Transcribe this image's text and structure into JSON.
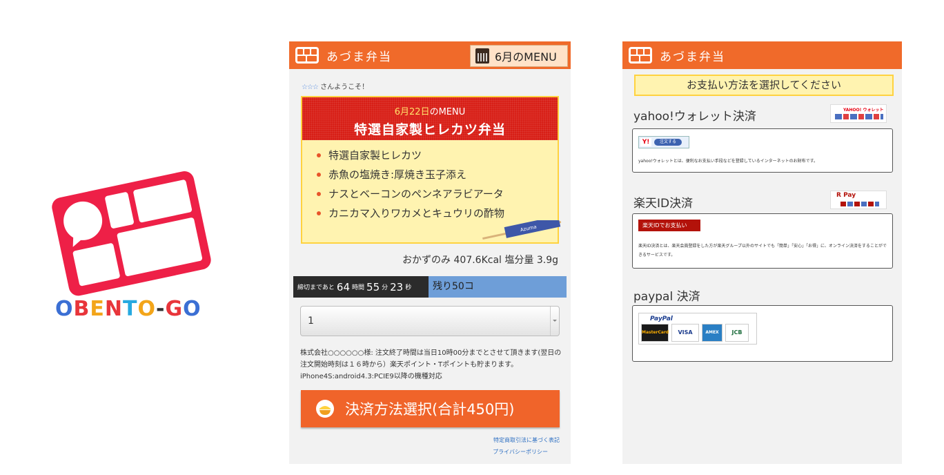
{
  "brand": {
    "wordmark": [
      {
        "ch": "O",
        "color": "#3b6fd4"
      },
      {
        "ch": "B",
        "color": "#e8353b"
      },
      {
        "ch": "E",
        "color": "#f3a51a"
      },
      {
        "ch": "N",
        "color": "#e8353b"
      },
      {
        "ch": "T",
        "color": "#27a9e0"
      },
      {
        "ch": "O",
        "color": "#f3a51a"
      },
      {
        "ch": "-",
        "color": "#333333"
      },
      {
        "ch": "G",
        "color": "#e8353b"
      },
      {
        "ch": "O",
        "color": "#3b6fd4"
      }
    ],
    "logo_color": "#ee2047"
  },
  "phone1": {
    "shop_name": "あづま弁当",
    "menu_button": "6月のMENU",
    "welcome_stars": "☆☆☆",
    "welcome_text": "さんようこそ！",
    "menu_date": "6月22日",
    "menu_date_suffix": "のMENU",
    "menu_title": "特選自家製ヒレカツ弁当",
    "menu_items": [
      "特選自家製ヒレカツ",
      "赤魚の塩焼き:厚焼き玉子添え",
      "ナスとベーコンのペンネアラビアータ",
      "カニカマ入りワカメとキュウリの酢物"
    ],
    "chopsticks_label": "Azuma",
    "calories": "おかずのみ 407.6Kcal 塩分量 3.9g",
    "countdown": {
      "prefix": "締切まであと",
      "hours": "64",
      "hours_unit": "時間",
      "minutes": "55",
      "minutes_unit": "分",
      "seconds": "23",
      "seconds_unit": "秒"
    },
    "remaining": "残り50コ",
    "quantity": "1",
    "notice": "株式会社○○○○○○様: 注文終了時間は当日10時00分までとさせて頂きます(翌日の注文開始時刻は１６時から）楽天ポイント・Tポイントも貯まります。 iPhone4S:android4.3:PCIE9以降の機種対応",
    "pay_button": "決済方法選択(合計450円)",
    "legal_link": "特定商取引法に基づく表記",
    "privacy_link": "プライバシーポリシー",
    "accent": "#f06a2a"
  },
  "phone2": {
    "shop_name": "あづま弁当",
    "select_heading": "お支払い方法を選択してください",
    "methods": [
      {
        "title": "yahoo!ウォレット決済",
        "button": "注文する",
        "logo": "YAHOO! ウォレット",
        "description": "yahoo!ウォレットとは、便利なお支払い手段などを登録しているインターネットのお財布です。"
      },
      {
        "title": "楽天ID決済",
        "button": "楽天IDでお支払い",
        "logo": "R Pay",
        "description": "楽天ID決済とは、楽天会員登録をした方が楽天グループ以外のサイトでも「簡単」「安心」「お得」に、オンライン決済をすることができるサービスです。"
      },
      {
        "title": "paypal 決済",
        "logo": "PayPal",
        "cards": [
          "MasterCard",
          "VISA",
          "AMEX",
          "JCB"
        ]
      }
    ]
  }
}
